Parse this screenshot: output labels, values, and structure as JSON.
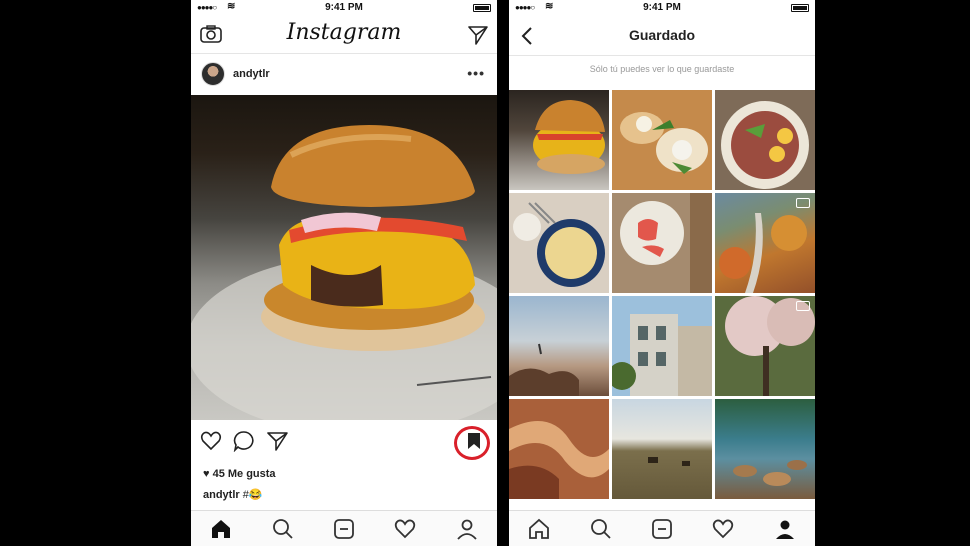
{
  "left_phone": {
    "status": {
      "time": "9:41 PM"
    },
    "header": {
      "logo": "Instagram",
      "left_icon": "camera-icon",
      "right_icon": "direct-icon"
    },
    "post": {
      "username": "andytlr",
      "more": "•••",
      "likes": "♥ 45 Me gusta",
      "caption_user": "andytlr",
      "caption_text": " #😂"
    },
    "actions": [
      "heart-icon",
      "comment-icon",
      "share-icon",
      "bookmark-icon"
    ],
    "highlight_color": "#d9202a"
  },
  "right_phone": {
    "status": {
      "time": "9:41 PM"
    },
    "header": {
      "title": "Guardado"
    },
    "note": "Sólo tú puedes ver lo que guardaste",
    "grid": [
      "burger",
      "toast-eggs",
      "egg-salad",
      "porridge-bowl",
      "salmon-plate",
      "aerial-autumn-video",
      "beach-cliffs",
      "victorian-houses",
      "blossom-tree-video",
      "slot-canyon",
      "grassland-animals",
      "lake-rocks"
    ]
  },
  "tabbar": [
    "home-icon",
    "search-icon",
    "camera-tab-icon",
    "activity-icon",
    "profile-icon"
  ],
  "colors": {
    "accent": "#d9202a",
    "text": "#222222",
    "muted": "#999999",
    "background": "#000000"
  }
}
